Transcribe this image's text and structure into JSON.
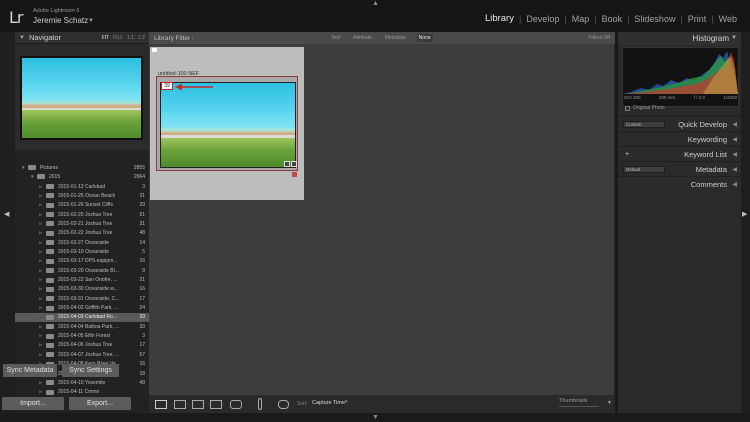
{
  "app": {
    "logo": "Lr",
    "product": "Adobe Lightroom 6",
    "user": "Jeremie Schatz"
  },
  "modules": [
    {
      "label": "Library",
      "active": true
    },
    {
      "label": "Develop",
      "active": false
    },
    {
      "label": "Map",
      "active": false
    },
    {
      "label": "Book",
      "active": false
    },
    {
      "label": "Slideshow",
      "active": false
    },
    {
      "label": "Print",
      "active": false
    },
    {
      "label": "Web",
      "active": false
    }
  ],
  "navigator": {
    "title": "Navigator",
    "zoom_options": [
      "FIT",
      "FILL",
      "1:1",
      "1:2"
    ]
  },
  "catalog": {
    "root": {
      "name": "Pictures",
      "count": "2855"
    },
    "year": {
      "name": "2015",
      "count": "2664"
    },
    "folders": [
      {
        "name": "2015-01-12 Carlsbad",
        "count": "3"
      },
      {
        "name": "2015-01-25 Ocean Beach",
        "count": "31"
      },
      {
        "name": "2015-01-26 Sunset Cliffs",
        "count": "29"
      },
      {
        "name": "2015-02-20 Joshua Tree",
        "count": "51"
      },
      {
        "name": "2015-02-21 Joshua Tree",
        "count": "31"
      },
      {
        "name": "2015-02-22 Joshua Tree",
        "count": "48"
      },
      {
        "name": "2015-02-27 Oceanside",
        "count": "14"
      },
      {
        "name": "2015-03-10 Oceanside",
        "count": "5"
      },
      {
        "name": "2015-03-17 DPS-equipm...",
        "count": "16"
      },
      {
        "name": "2015-03-20 Oceanside Bl...",
        "count": "9"
      },
      {
        "name": "2015-03-22 San Onofre, ...",
        "count": "21"
      },
      {
        "name": "2015-03-30 Oceanside w...",
        "count": "16"
      },
      {
        "name": "2015-03-31 Oceanside, C...",
        "count": "17"
      },
      {
        "name": "2015-04-02 Griffith Park, ...",
        "count": "24"
      },
      {
        "name": "2015-04-03 Carlsbad Ro...",
        "count": "39",
        "selected": true
      },
      {
        "name": "2015-04-04 Balboa Park, ...",
        "count": "33"
      },
      {
        "name": "2015-04-05 Elfin Forest",
        "count": "3"
      },
      {
        "name": "2015-04-06 Joshua Tree",
        "count": "17"
      },
      {
        "name": "2015-04-07 Joshua Tree, ...",
        "count": "57"
      },
      {
        "name": "2015-04-08 Kern River Va...",
        "count": "16"
      },
      {
        "name": "2015-04-09 Kern River, V...",
        "count": "18"
      },
      {
        "name": "2015-04-10 Yosemite",
        "count": "49"
      },
      {
        "name": "2015-04-11 Cmmo",
        "count": ""
      }
    ]
  },
  "buttons": {
    "import": "Import...",
    "export": "Export...",
    "sync_metadata": "Sync Metadata",
    "sync_settings": "Sync Settings"
  },
  "filter_bar": {
    "label": "Library Filter :",
    "options": [
      {
        "label": "Text",
        "selected": false
      },
      {
        "label": "Attribute",
        "selected": false
      },
      {
        "label": "Metadata",
        "selected": false
      },
      {
        "label": "None",
        "selected": true
      }
    ],
    "status": "Filters Off"
  },
  "grid": {
    "cell": {
      "filename": "untitled-100.NEF",
      "index": "39"
    }
  },
  "toolbar": {
    "sort_label": "Sort:",
    "sort_value": "Capture Time",
    "thumbnails_label": "Thumbnails"
  },
  "histogram": {
    "title": "Histogram",
    "iso": "ISO 200",
    "focal": "200 mm",
    "aperture": "f / 2.0",
    "shutter": "1/3200",
    "original_photo": "Original Photo"
  },
  "right_sections": [
    {
      "title": "Quick Develop",
      "control": "select",
      "control_value": "Custom"
    },
    {
      "title": "Keywording",
      "control": "none"
    },
    {
      "title": "Keyword List",
      "control": "plus",
      "control_value": "+"
    },
    {
      "title": "Metadata",
      "control": "select",
      "control_value": "Default"
    },
    {
      "title": "Comments",
      "control": "none"
    }
  ]
}
